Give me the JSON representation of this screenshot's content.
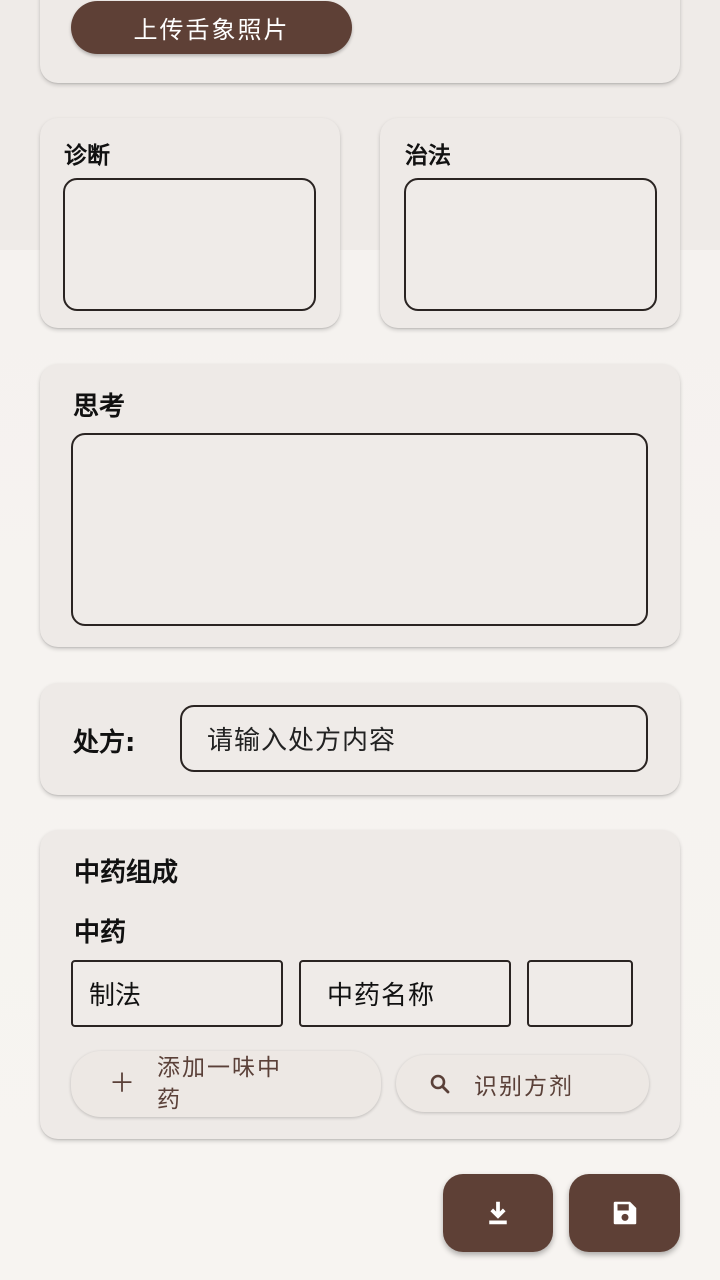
{
  "upload": {
    "button_label": "上传舌象照片"
  },
  "diagnosis": {
    "label": "诊断",
    "value": ""
  },
  "treatment": {
    "label": "治法",
    "value": ""
  },
  "thinking": {
    "label": "思考",
    "value": ""
  },
  "prescription": {
    "label": "处方:",
    "placeholder": "请输入处方内容"
  },
  "herbs": {
    "section_title": "中药组成",
    "subtitle": "中药",
    "row": {
      "method_placeholder": "制法",
      "name_placeholder": "中药名称",
      "dose_value": ""
    },
    "add_button": {
      "label_line1": "添加一味中",
      "label_line2": "药",
      "icon": "plus-icon"
    },
    "identify_button": {
      "label": "识别方剂",
      "icon": "search-icon"
    }
  },
  "fabs": {
    "download_icon": "download-icon",
    "save_icon": "save-icon"
  },
  "colors": {
    "primary": "#5e4036",
    "card": "#eeeae7",
    "background": "#f5f2ef",
    "border": "#2a2422"
  }
}
